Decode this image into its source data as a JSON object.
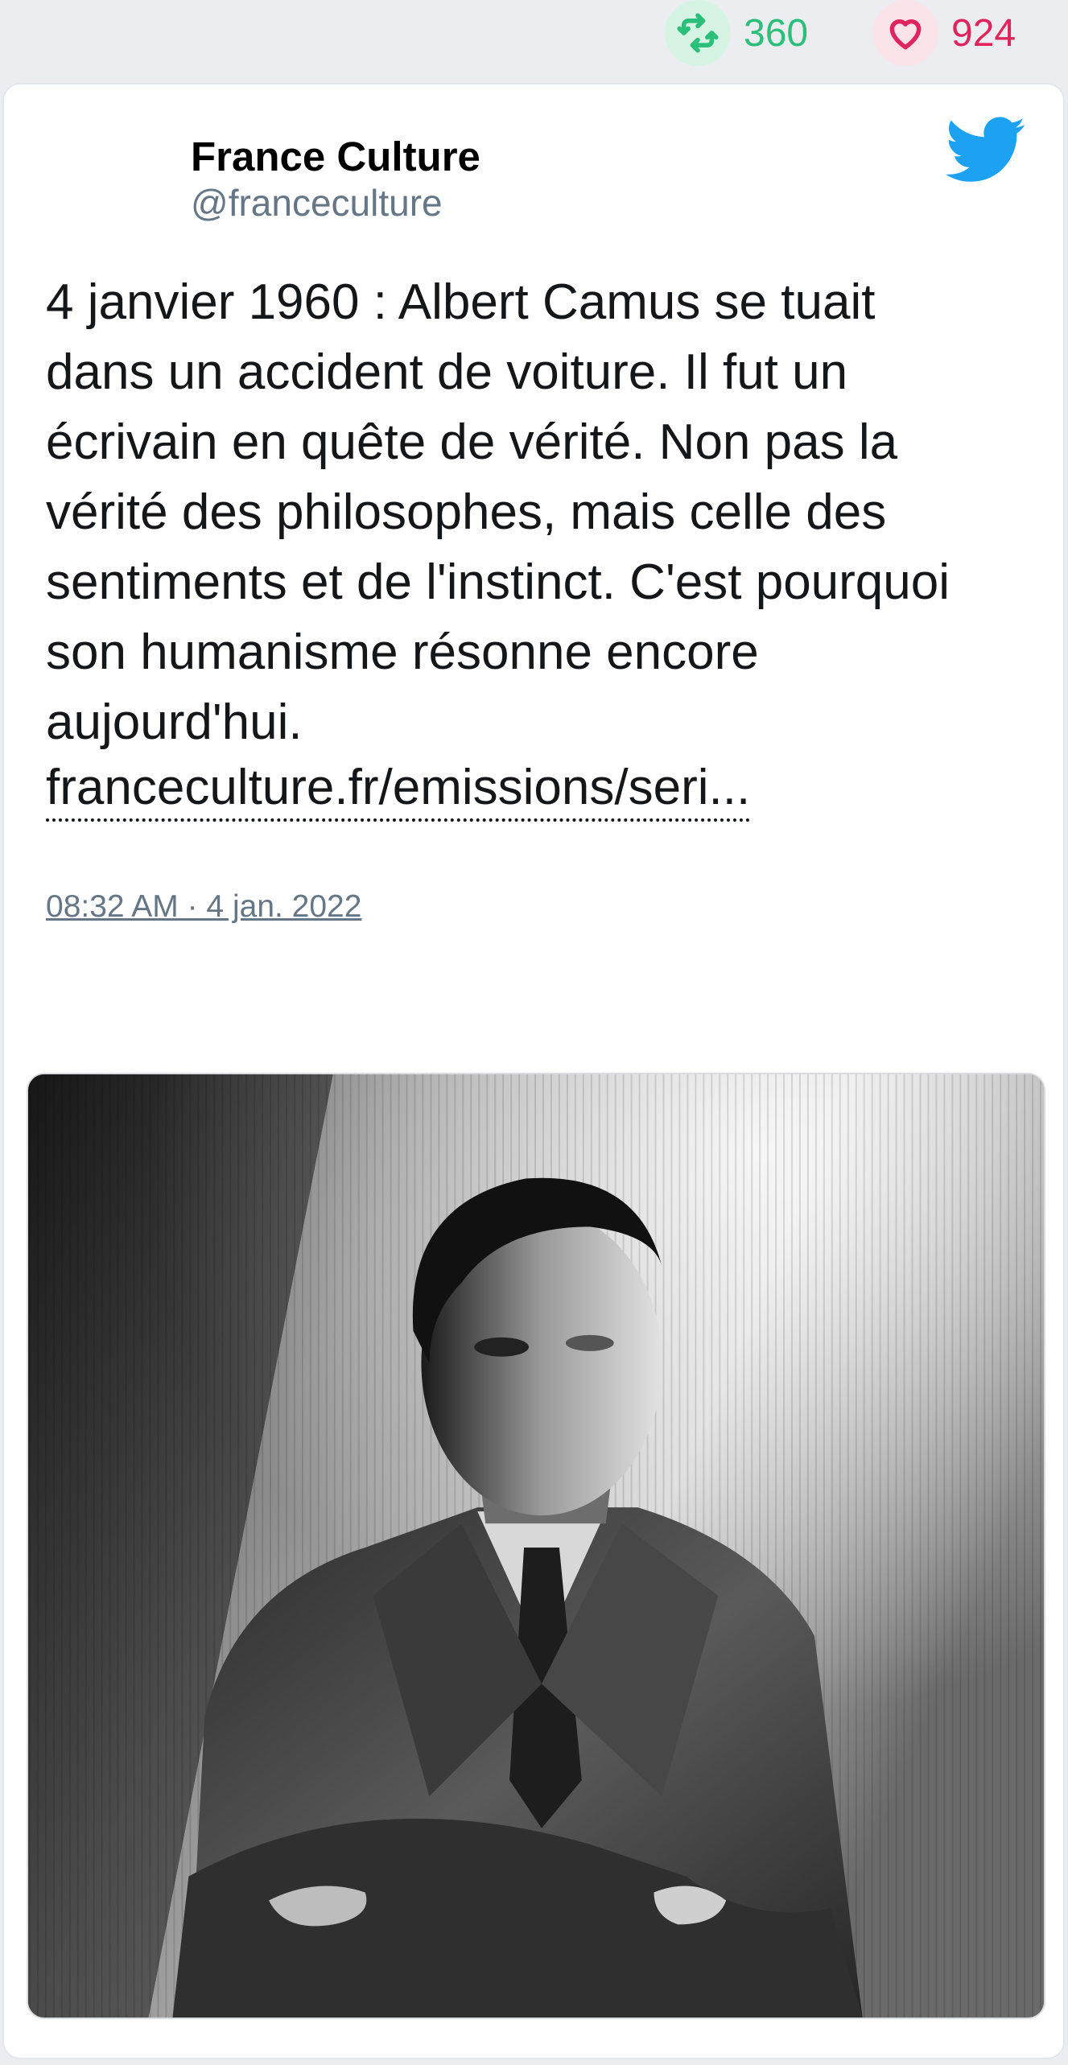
{
  "stats": {
    "retweets": "360",
    "likes": "924"
  },
  "author": {
    "display_name": "France Culture",
    "handle": "@franceculture"
  },
  "tweet": {
    "lines": [
      "4 janvier 1960 : Albert Camus se tuait",
      "dans un accident de voiture. Il fut un",
      "écrivain en quête de vérité. Non pas la",
      "vérité des philosophes, mais celle des",
      "sentiments et de l'instinct. C'est pourquoi",
      "son humanisme résonne encore",
      "aujourd'hui."
    ],
    "link": "franceculture.fr/emissions/seri...",
    "timestamp": "08:32 AM · 4 jan. 2022"
  },
  "icons": {
    "retweet": "retweet-icon",
    "like": "heart-icon",
    "reply": "reply-icon",
    "brand": "twitter-bird-icon"
  },
  "colors": {
    "retweet": "#2bbf7a",
    "like": "#e0245e",
    "twitter_blue": "#1da1f2",
    "muted": "#657786"
  }
}
